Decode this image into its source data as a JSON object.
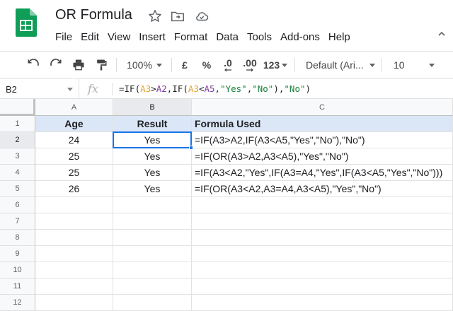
{
  "app": {
    "title": "OR Formula",
    "menu": [
      "File",
      "Edit",
      "View",
      "Insert",
      "Format",
      "Data",
      "Tools",
      "Add-ons",
      "Help"
    ],
    "icons": [
      "sheets-logo-icon",
      "star-icon",
      "move-to-folder-icon",
      "cloud-saved-icon",
      "collapse-menu-icon"
    ],
    "brand_color": "#0f9d58"
  },
  "toolbar": {
    "zoom": "100%",
    "currency": "£",
    "percent": "%",
    "decrease_decimal": ".0",
    "increase_decimal": ".00",
    "more_formats": "123",
    "font": "Default (Ari...",
    "font_size": "10"
  },
  "formula_bar": {
    "name_box": "B2",
    "fx": "fx",
    "parts": [
      {
        "t": "=IF(",
        "c": ""
      },
      {
        "t": "A3",
        "c": "r-orange"
      },
      {
        "t": ">",
        "c": ""
      },
      {
        "t": "A2",
        "c": "r-purple"
      },
      {
        "t": ",IF(",
        "c": ""
      },
      {
        "t": "A3",
        "c": "r-orange"
      },
      {
        "t": "<",
        "c": ""
      },
      {
        "t": "A5",
        "c": "r-purple"
      },
      {
        "t": ",",
        "c": ""
      },
      {
        "t": "\"Yes\"",
        "c": "s-green"
      },
      {
        "t": ",",
        "c": ""
      },
      {
        "t": "\"No\"",
        "c": "s-green"
      },
      {
        "t": "),",
        "c": ""
      },
      {
        "t": "\"No\"",
        "c": "s-green"
      },
      {
        "t": ")",
        "c": ""
      }
    ]
  },
  "grid": {
    "columns": [
      "A",
      "B",
      "C"
    ],
    "row_numbers": [
      "1",
      "2",
      "3",
      "4",
      "5",
      "6",
      "7",
      "8",
      "9",
      "10",
      "11",
      "12"
    ],
    "selected_cell": "B2",
    "header_fill": "#dbe7f7",
    "rows": [
      [
        "Age",
        "Result",
        "Formula Used"
      ],
      [
        "24",
        "Yes",
        "=IF(A3>A2,IF(A3<A5,\"Yes\",\"No\"),\"No\")"
      ],
      [
        "25",
        "Yes",
        "=IF(OR(A3>A2,A3<A5),\"Yes\",\"No\")"
      ],
      [
        "25",
        "Yes",
        "=IF(A3<A2,\"Yes\",IF(A3=A4,\"Yes\",IF(A3<A5,\"Yes\",\"No\")))"
      ],
      [
        "26",
        "Yes",
        "=IF(OR(A3<A2,A3=A4,A3<A5),\"Yes\",\"No\")"
      ]
    ]
  }
}
